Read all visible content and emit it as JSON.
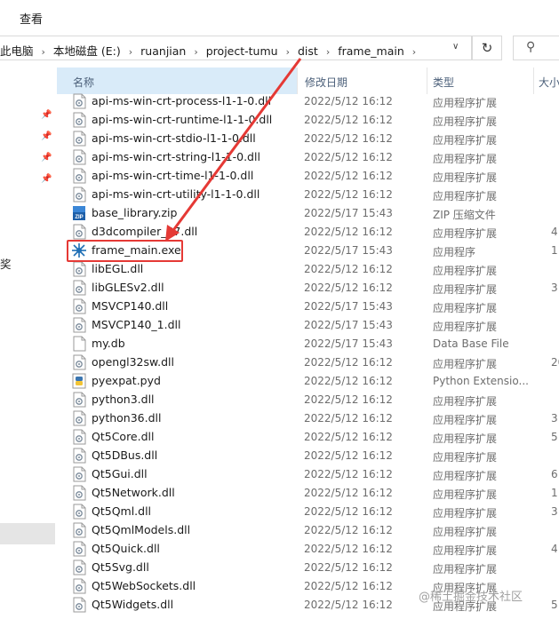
{
  "ribbon": {
    "tab_view": "查看"
  },
  "address": {
    "crumbs": [
      "此电脑",
      "本地磁盘 (E:)",
      "ruanjian",
      "project-tumu",
      "dist",
      "frame_main"
    ],
    "separator": "›"
  },
  "nav": {
    "partial_label": "奖"
  },
  "columns": {
    "name": "名称",
    "date": "修改日期",
    "type": "类型",
    "size": "大小"
  },
  "files": [
    {
      "name": "api-ms-win-crt-process-l1-1-0.dll",
      "date": "2022/5/12 16:12",
      "type": "应用程序扩展",
      "size": "",
      "icon": "dll-icon"
    },
    {
      "name": "api-ms-win-crt-runtime-l1-1-0.dll",
      "date": "2022/5/12 16:12",
      "type": "应用程序扩展",
      "size": "",
      "icon": "dll-icon"
    },
    {
      "name": "api-ms-win-crt-stdio-l1-1-0.dll",
      "date": "2022/5/12 16:12",
      "type": "应用程序扩展",
      "size": "",
      "icon": "dll-icon"
    },
    {
      "name": "api-ms-win-crt-string-l1-1-0.dll",
      "date": "2022/5/12 16:12",
      "type": "应用程序扩展",
      "size": "",
      "icon": "dll-icon"
    },
    {
      "name": "api-ms-win-crt-time-l1-1-0.dll",
      "date": "2022/5/12 16:12",
      "type": "应用程序扩展",
      "size": "",
      "icon": "dll-icon"
    },
    {
      "name": "api-ms-win-crt-utility-l1-1-0.dll",
      "date": "2022/5/12 16:12",
      "type": "应用程序扩展",
      "size": "",
      "icon": "dll-icon"
    },
    {
      "name": "base_library.zip",
      "date": "2022/5/17 15:43",
      "type": "ZIP 压缩文件",
      "size": "",
      "icon": "zip-icon"
    },
    {
      "name": "d3dcompiler_47.dll",
      "date": "2022/5/12 16:12",
      "type": "应用程序扩展",
      "size": "4",
      "icon": "dll-icon"
    },
    {
      "name": "frame_main.exe",
      "date": "2022/5/17 15:43",
      "type": "应用程序",
      "size": "1",
      "icon": "exe-icon"
    },
    {
      "name": "libEGL.dll",
      "date": "2022/5/12 16:12",
      "type": "应用程序扩展",
      "size": "",
      "icon": "dll-icon"
    },
    {
      "name": "libGLESv2.dll",
      "date": "2022/5/12 16:12",
      "type": "应用程序扩展",
      "size": "3",
      "icon": "dll-icon"
    },
    {
      "name": "MSVCP140.dll",
      "date": "2022/5/17 15:43",
      "type": "应用程序扩展",
      "size": "",
      "icon": "dll-icon"
    },
    {
      "name": "MSVCP140_1.dll",
      "date": "2022/5/17 15:43",
      "type": "应用程序扩展",
      "size": "",
      "icon": "dll-icon"
    },
    {
      "name": "my.db",
      "date": "2022/5/17 15:43",
      "type": "Data Base File",
      "size": "",
      "icon": "file-icon"
    },
    {
      "name": "opengl32sw.dll",
      "date": "2022/5/12 16:12",
      "type": "应用程序扩展",
      "size": "20",
      "icon": "dll-icon"
    },
    {
      "name": "pyexpat.pyd",
      "date": "2022/5/12 16:12",
      "type": "Python Extensio...",
      "size": "",
      "icon": "python-icon"
    },
    {
      "name": "python3.dll",
      "date": "2022/5/12 16:12",
      "type": "应用程序扩展",
      "size": "",
      "icon": "dll-icon"
    },
    {
      "name": "python36.dll",
      "date": "2022/5/12 16:12",
      "type": "应用程序扩展",
      "size": "3",
      "icon": "dll-icon"
    },
    {
      "name": "Qt5Core.dll",
      "date": "2022/5/12 16:12",
      "type": "应用程序扩展",
      "size": "5",
      "icon": "dll-icon"
    },
    {
      "name": "Qt5DBus.dll",
      "date": "2022/5/12 16:12",
      "type": "应用程序扩展",
      "size": "",
      "icon": "dll-icon"
    },
    {
      "name": "Qt5Gui.dll",
      "date": "2022/5/12 16:12",
      "type": "应用程序扩展",
      "size": "6",
      "icon": "dll-icon"
    },
    {
      "name": "Qt5Network.dll",
      "date": "2022/5/12 16:12",
      "type": "应用程序扩展",
      "size": "1",
      "icon": "dll-icon"
    },
    {
      "name": "Qt5Qml.dll",
      "date": "2022/5/12 16:12",
      "type": "应用程序扩展",
      "size": "3",
      "icon": "dll-icon"
    },
    {
      "name": "Qt5QmlModels.dll",
      "date": "2022/5/12 16:12",
      "type": "应用程序扩展",
      "size": "",
      "icon": "dll-icon"
    },
    {
      "name": "Qt5Quick.dll",
      "date": "2022/5/12 16:12",
      "type": "应用程序扩展",
      "size": "4",
      "icon": "dll-icon"
    },
    {
      "name": "Qt5Svg.dll",
      "date": "2022/5/12 16:12",
      "type": "应用程序扩展",
      "size": "",
      "icon": "dll-icon"
    },
    {
      "name": "Qt5WebSockets.dll",
      "date": "2022/5/12 16:12",
      "type": "应用程序扩展",
      "size": "",
      "icon": "dll-icon"
    },
    {
      "name": "Qt5Widgets.dll",
      "date": "2022/5/12 16:12",
      "type": "应用程序扩展",
      "size": "5",
      "icon": "dll-icon"
    }
  ],
  "watermark": "@稀土掘金技术社区",
  "colors": {
    "highlight": "#e53935",
    "header_selected": "#d9ebf9"
  }
}
